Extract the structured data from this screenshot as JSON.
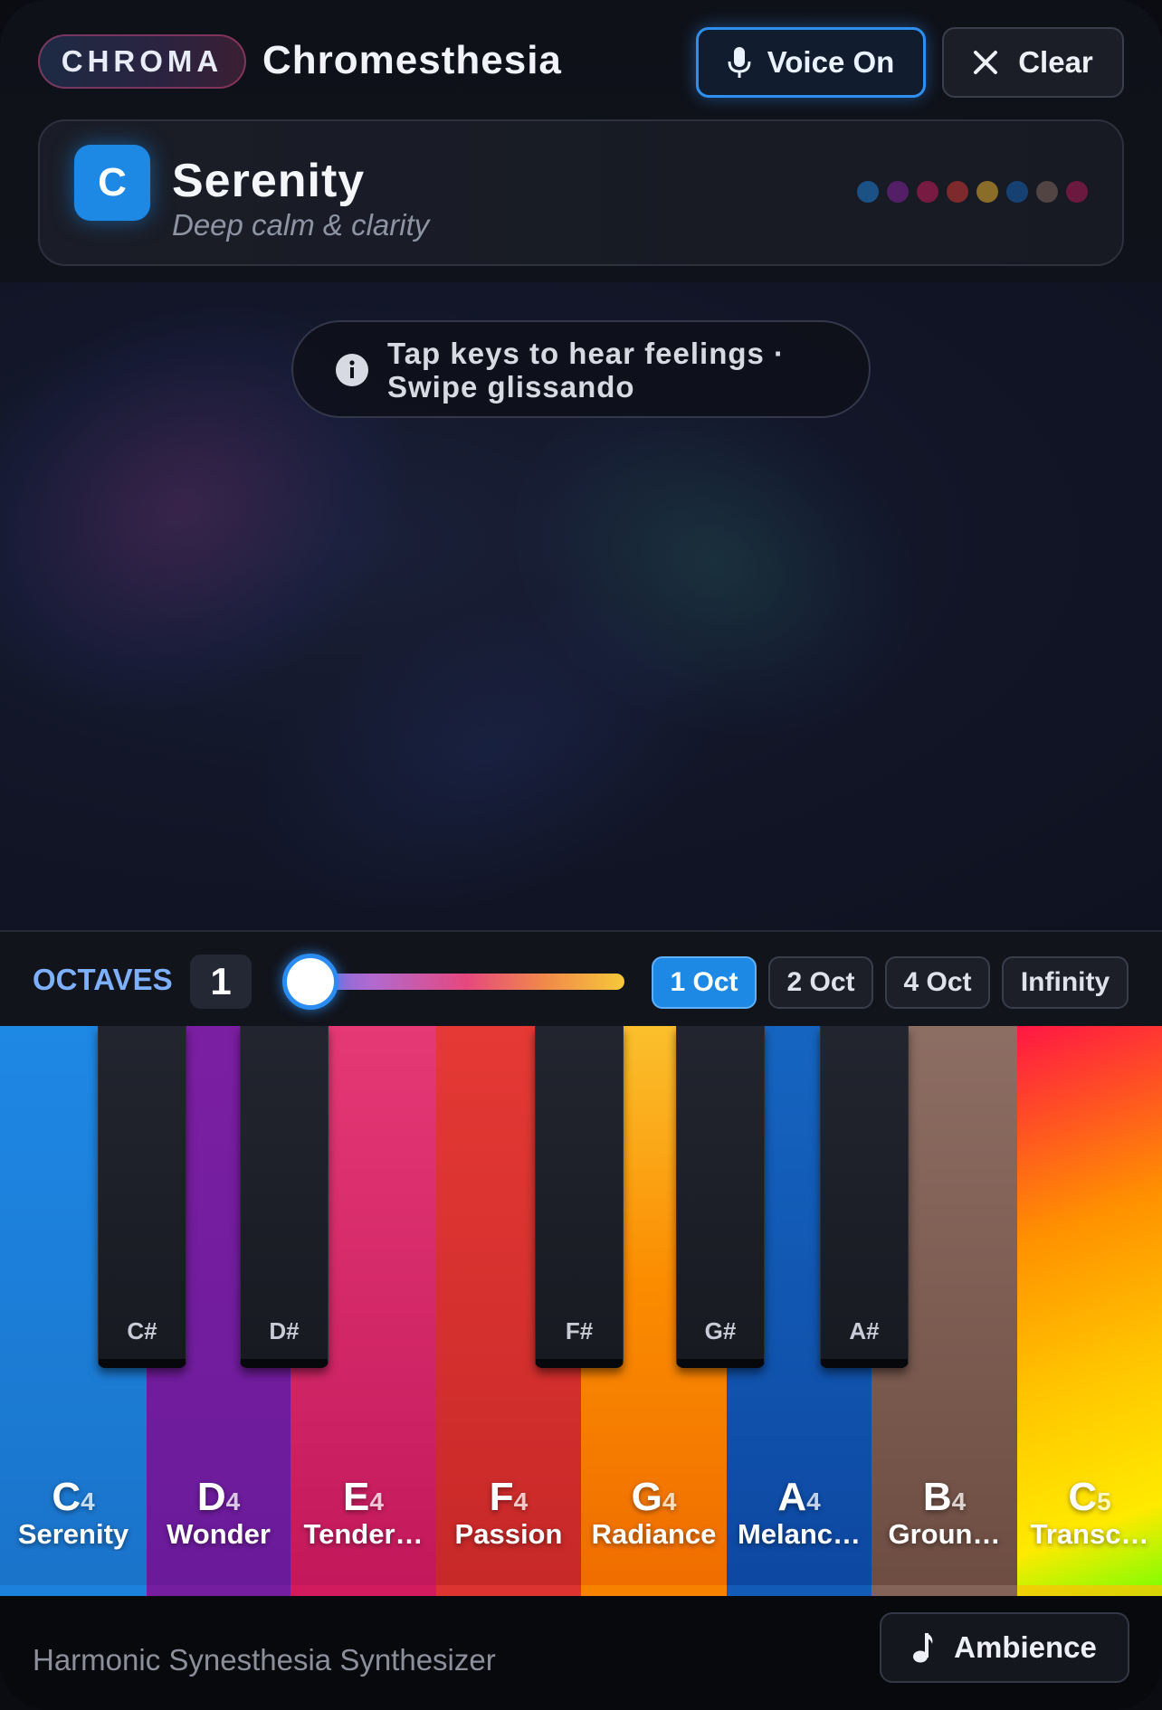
{
  "header": {
    "brand": "CHROMA",
    "title": "Chromesthesia",
    "voice_label": "Voice On",
    "clear_label": "Clear"
  },
  "mood": {
    "key": "C",
    "name": "Serenity",
    "description": "Deep calm & clarity",
    "dot_colors": [
      "#1e88e5",
      "#8e24aa",
      "#d81b60",
      "#e53935",
      "#fbc02d",
      "#1565c0",
      "#8d6e63",
      "#c2185b"
    ]
  },
  "canvas": {
    "hint": "Tap keys to hear feelings · Swipe glissando"
  },
  "octaves": {
    "label": "OCTAVES",
    "value": "1",
    "slider_fraction": 0.0,
    "options": [
      "1 Oct",
      "2 Oct",
      "4 Oct",
      "Infinity"
    ],
    "selected": "1 Oct"
  },
  "keys": {
    "white": [
      {
        "note": "C",
        "octave": "4",
        "feeling": "Serenity",
        "color": "#1e88e5"
      },
      {
        "note": "D",
        "octave": "4",
        "feeling": "Wonder",
        "color": "#7b1fa2"
      },
      {
        "note": "E",
        "octave": "4",
        "feeling": "Tender…",
        "color": "#d81b60"
      },
      {
        "note": "F",
        "octave": "4",
        "feeling": "Passion",
        "color": "#e53935"
      },
      {
        "note": "G",
        "octave": "4",
        "feeling": "Radiance",
        "color": "#fb8c00"
      },
      {
        "note": "A",
        "octave": "4",
        "feeling": "Melanc…",
        "color": "#1565c0"
      },
      {
        "note": "B",
        "octave": "4",
        "feeling": "Groun…",
        "color": "#8d6e63"
      },
      {
        "note": "C",
        "octave": "5",
        "feeling": "Transc…",
        "color": "#ffc107"
      }
    ],
    "black": [
      "C#",
      "D#",
      "F#",
      "G#",
      "A#"
    ]
  },
  "footer": {
    "text": "Harmonic Synesthesia Synthesizer",
    "ambience_label": "Ambience"
  }
}
